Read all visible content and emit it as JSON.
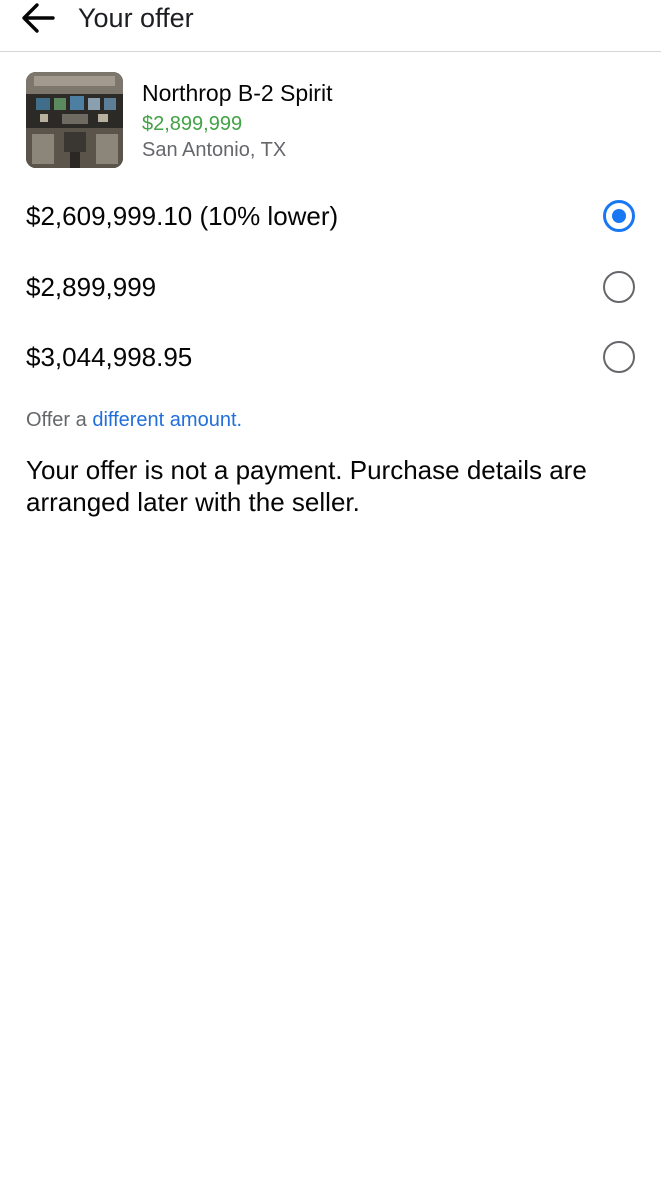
{
  "header": {
    "title": "Your offer",
    "back_icon": "back-arrow-icon"
  },
  "listing": {
    "title": "Northrop B-2 Spirit",
    "price": "$2,899,999",
    "location": "San Antonio, TX",
    "price_color": "#42a244"
  },
  "offer_options": [
    {
      "label": "$2,609,999.10 (10% lower)",
      "selected": true
    },
    {
      "label": "$2,899,999",
      "selected": false
    },
    {
      "label": "$3,044,998.95",
      "selected": false
    }
  ],
  "different_amount": {
    "prefix": "Offer a ",
    "link": "different amount."
  },
  "note": "Your offer is not a payment. Purchase details are arranged later with the seller.",
  "colors": {
    "accent": "#1877f2",
    "link": "#216fdb",
    "secondary_text": "#65676b"
  }
}
